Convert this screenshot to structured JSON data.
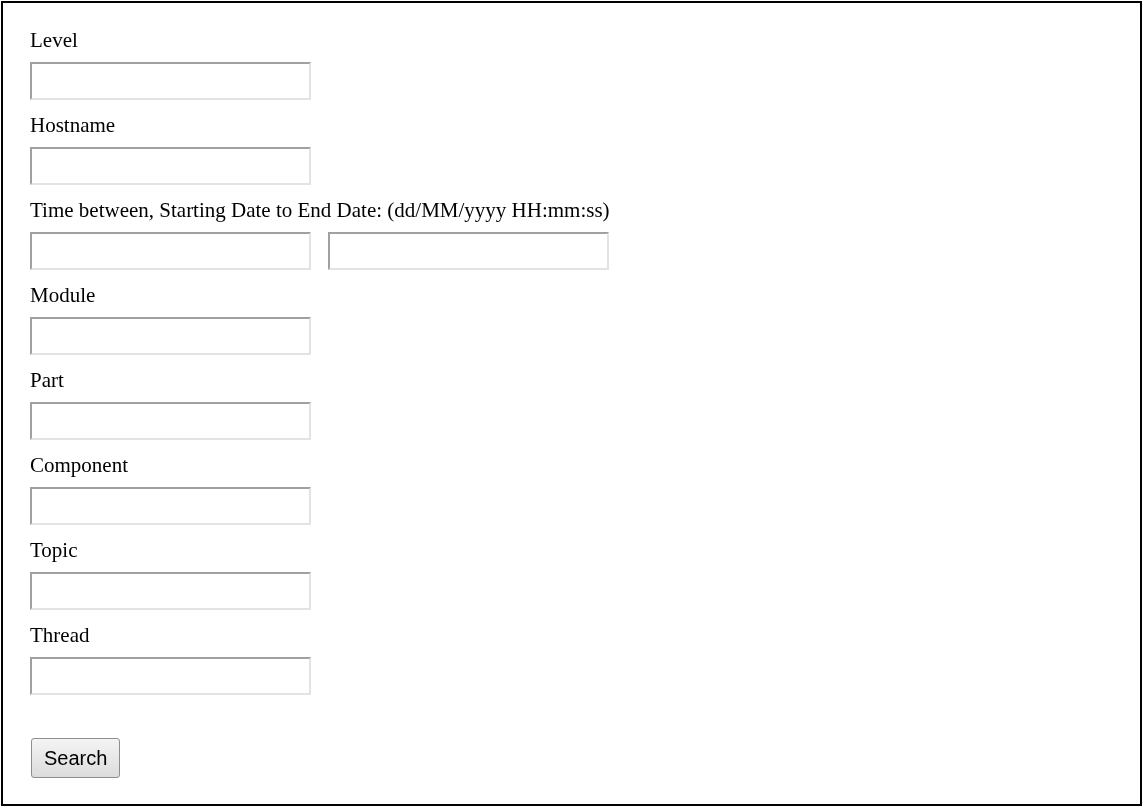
{
  "fields": [
    {
      "kind": "single",
      "label": "Level"
    },
    {
      "kind": "single",
      "label": "Hostname"
    },
    {
      "kind": "range",
      "label": "Time between, Starting Date to End Date: (dd/MM/yyyy HH:mm:ss)"
    },
    {
      "kind": "single",
      "label": "Module"
    },
    {
      "kind": "single",
      "label": "Part"
    },
    {
      "kind": "single",
      "label": "Component"
    },
    {
      "kind": "single",
      "label": "Topic"
    },
    {
      "kind": "single",
      "label": "Thread"
    }
  ],
  "button": "Search"
}
